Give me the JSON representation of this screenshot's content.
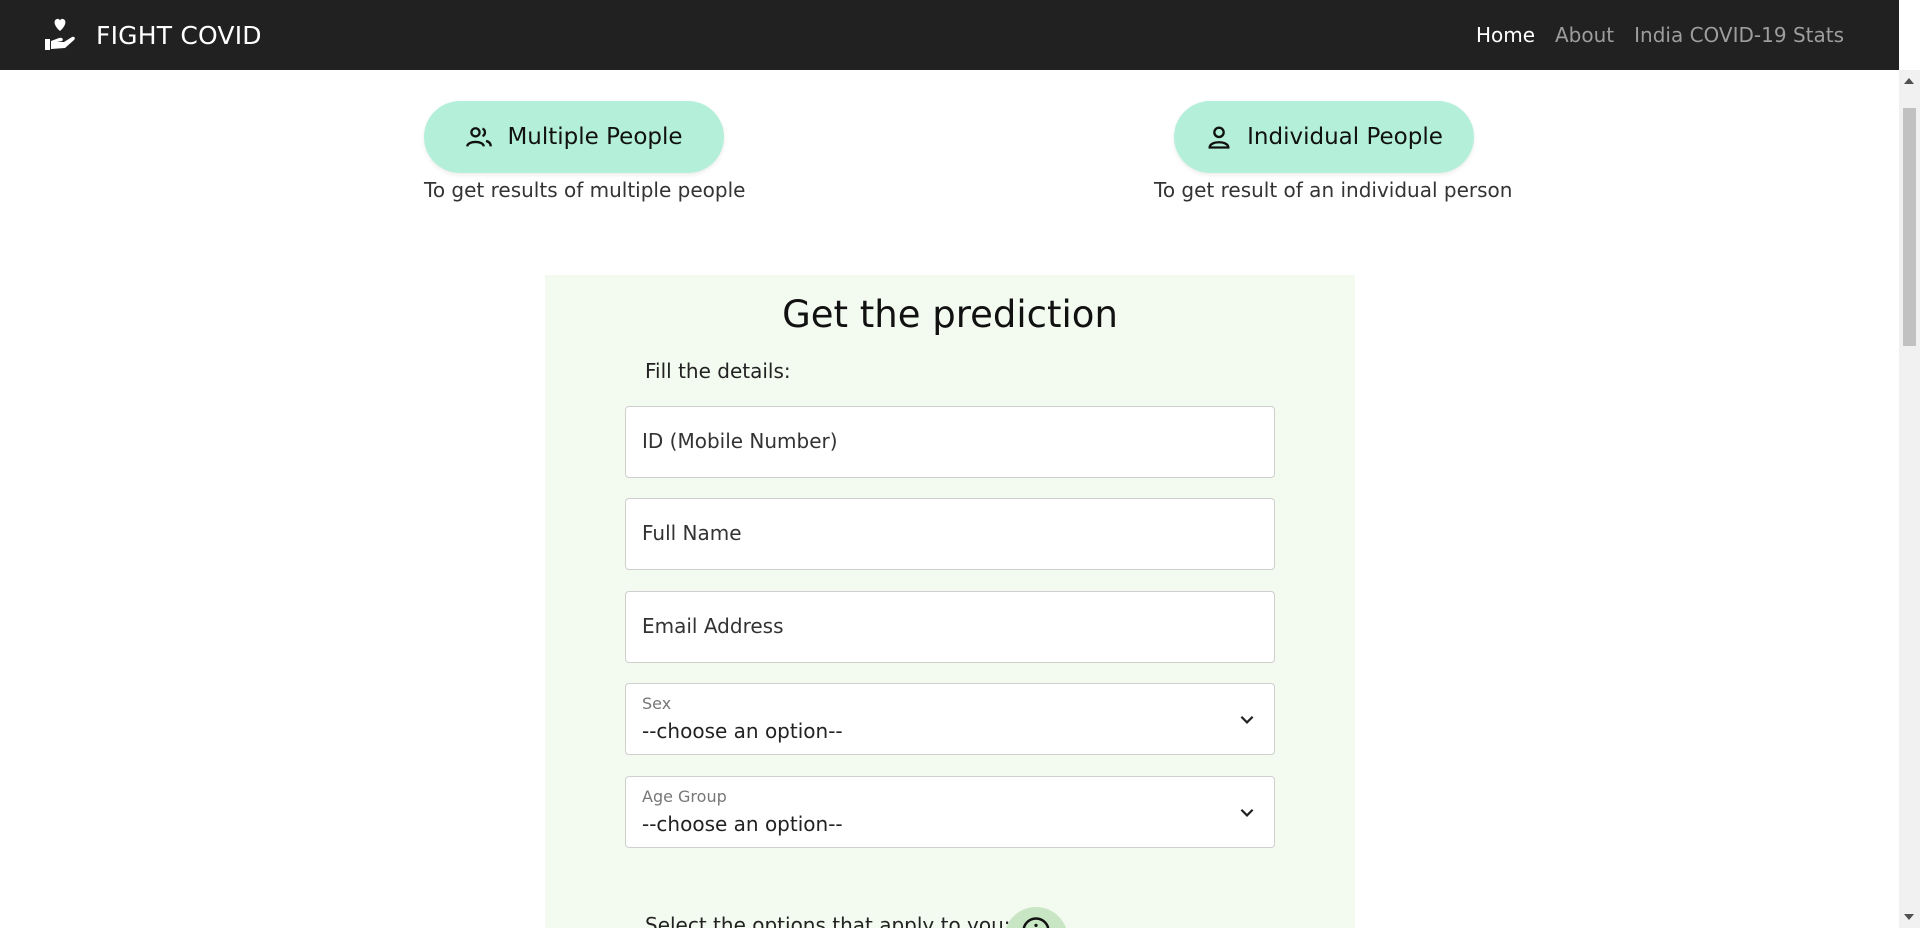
{
  "navbar": {
    "brand": "FIGHT COVID",
    "links": [
      {
        "label": "Home",
        "active": true
      },
      {
        "label": "About",
        "active": false
      },
      {
        "label": "India COVID-19 Stats",
        "active": false
      }
    ]
  },
  "modes": {
    "multiple": {
      "label": "Multiple People",
      "desc": "To get results of multiple people",
      "icon": "people-icon"
    },
    "individual": {
      "label": "Individual People",
      "desc": "To get result of an individual person",
      "icon": "person-icon"
    }
  },
  "form": {
    "title": "Get the prediction",
    "subtitle": "Fill the details:",
    "id_placeholder": "ID (Mobile Number)",
    "name_placeholder": "Full Name",
    "email_placeholder": "Email Address",
    "sex": {
      "label": "Sex",
      "value": "--choose an option--"
    },
    "age": {
      "label": "Age Group",
      "value": "--choose an option--"
    },
    "select_options_text": "Select the options that apply to you:"
  },
  "colors": {
    "navbar_bg": "#212121",
    "mode_button_bg": "#b3efd9",
    "card_bg": "#f3faf0",
    "info_button_bg": "#c9e6c4"
  }
}
